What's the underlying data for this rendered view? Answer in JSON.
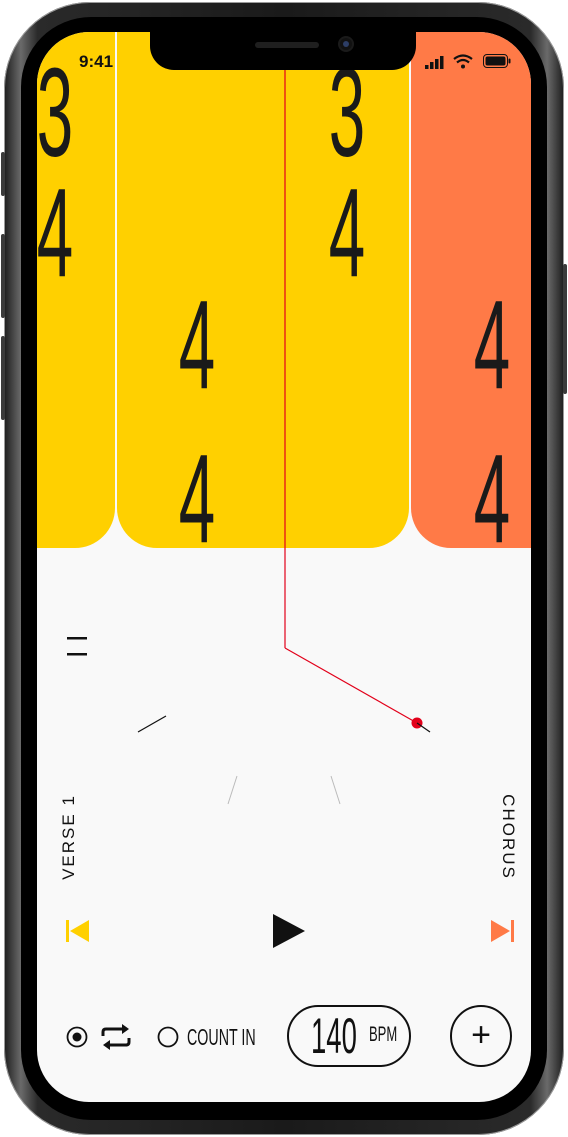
{
  "status_bar": {
    "time": "9:41"
  },
  "bars": [
    {
      "top": "3",
      "bottom": "4"
    },
    {
      "top": "4",
      "bottom": "4"
    },
    {
      "top": "3",
      "bottom": "4"
    },
    {
      "top": "4",
      "bottom": "4"
    }
  ],
  "colors": {
    "yellow": "#FFD000",
    "orange": "#FF7A47",
    "playhead": "#E2001A",
    "background": "#F9F9F9"
  },
  "sections": {
    "left": "VERSE 1",
    "right": "CHORUS"
  },
  "controls": {
    "count_in_label": "COUNT IN",
    "tempo_value": "140",
    "tempo_unit": "BPM",
    "add_symbol": "+"
  },
  "icons": [
    "menu-icon",
    "skip-back-icon",
    "play-icon",
    "skip-forward-icon",
    "record-dot-icon",
    "loop-icon",
    "radio-icon",
    "plus-icon",
    "signal-icon",
    "wifi-icon",
    "battery-icon"
  ]
}
